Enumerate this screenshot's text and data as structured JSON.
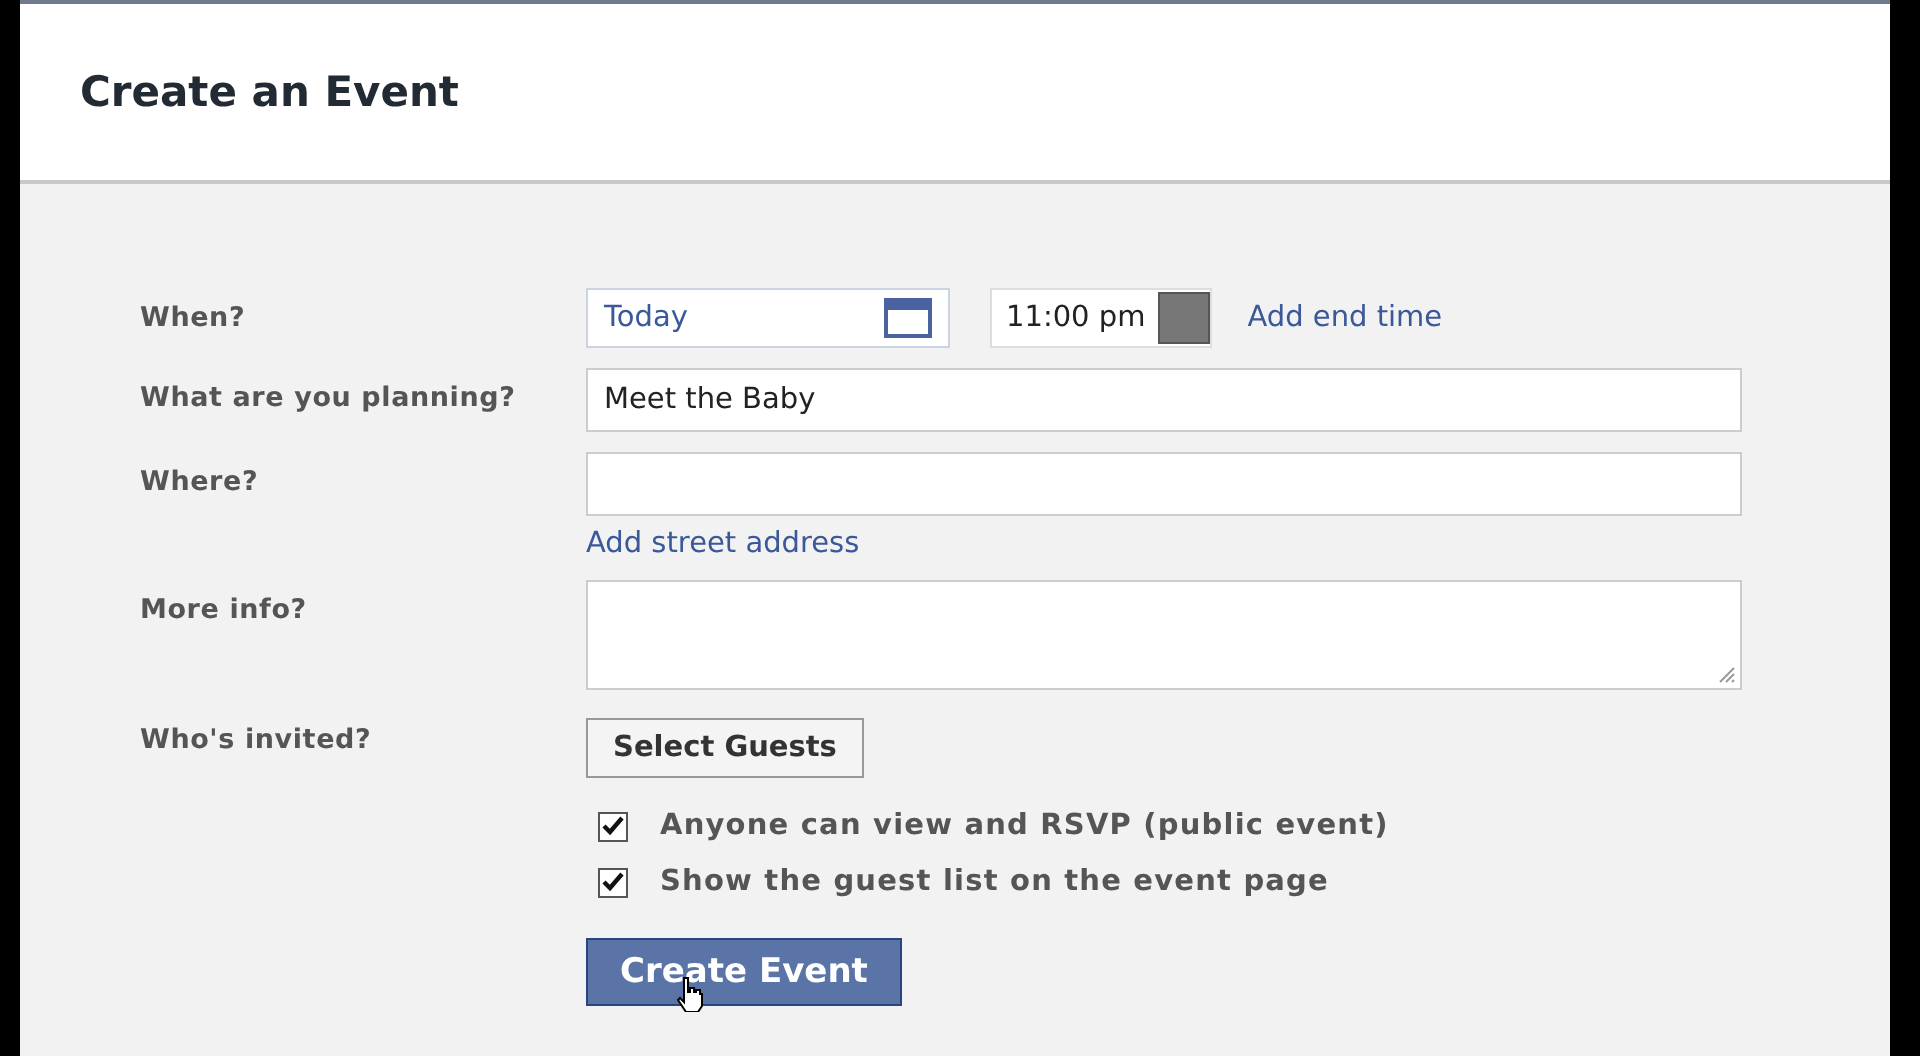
{
  "title": "Create an Event",
  "when": {
    "label": "When?",
    "date": {
      "value": "Today"
    },
    "time": {
      "value": "11:00 pm"
    },
    "add_end_time": "Add end time"
  },
  "planning": {
    "label": "What are you planning?",
    "value": "Meet the Baby"
  },
  "where": {
    "label": "Where?",
    "add_street_address": "Add street address"
  },
  "more_info": {
    "label": "More info?"
  },
  "invited": {
    "label": "Who's invited?",
    "button": "Select Guests"
  },
  "options": [
    {
      "label": "Anyone can view and RSVP (public event)",
      "checked": true
    },
    {
      "label": "Show the guest list on the event page",
      "checked": true
    }
  ],
  "submit": "Create Event"
}
